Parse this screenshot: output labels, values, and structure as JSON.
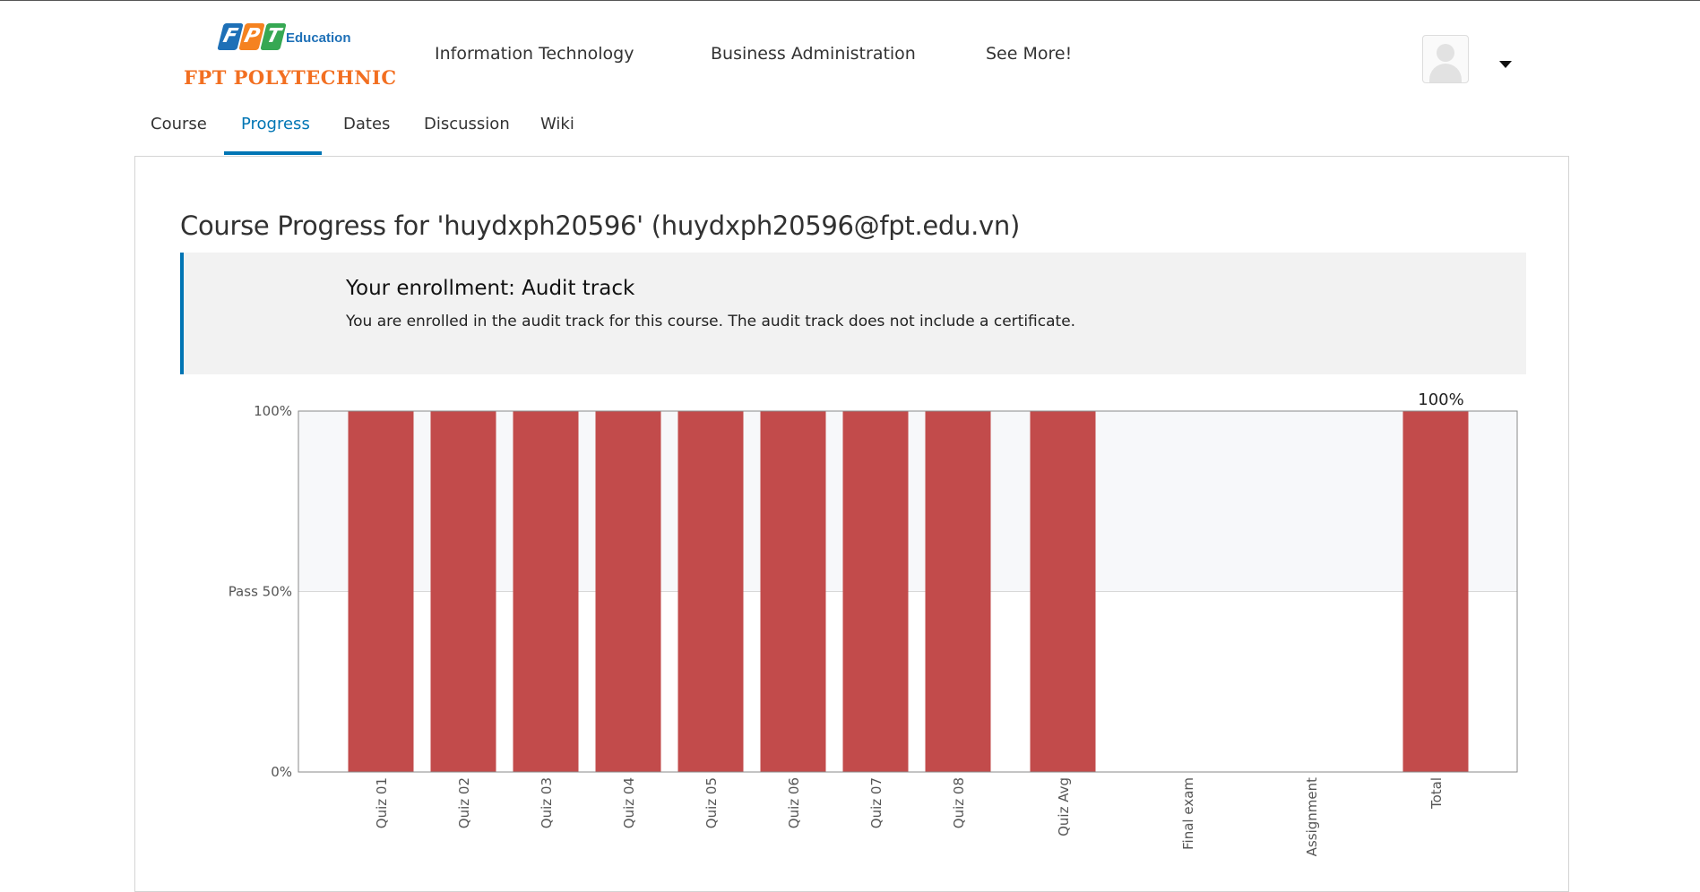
{
  "header": {
    "logo": {
      "brand": "FPT",
      "tagline": "Education",
      "name": "FPT POLYTECHNIC"
    },
    "nav": [
      "Information Technology",
      "Business Administration",
      "See More!"
    ]
  },
  "course_tabs": [
    "Course",
    "Progress",
    "Dates",
    "Discussion",
    "Wiki"
  ],
  "active_tab": "Progress",
  "page_title": "Course Progress for 'huydxph20596' (huydxph20596@fpt.edu.vn)",
  "enrollment": {
    "heading": "Your enrollment: Audit track",
    "text": "You are enrolled in the audit track for this course. The audit track does not include a certificate."
  },
  "colors": {
    "accent": "#0075b4",
    "bar": "#c24b4b",
    "pass_band": "#f7f8fa"
  },
  "chart_data": {
    "type": "bar",
    "categories": [
      "Quiz 01",
      "Quiz 02",
      "Quiz 03",
      "Quiz 04",
      "Quiz 05",
      "Quiz 06",
      "Quiz 07",
      "Quiz 08",
      "Quiz Avg",
      "Final exam",
      "Assignment",
      "Total"
    ],
    "values": [
      100,
      100,
      100,
      100,
      100,
      100,
      100,
      100,
      100,
      0,
      0,
      100
    ],
    "ylim": [
      0,
      100
    ],
    "yticks": [
      {
        "value": 0,
        "label": "0%"
      },
      {
        "value": 50,
        "label": "Pass 50%"
      },
      {
        "value": 100,
        "label": "100%"
      }
    ],
    "pass_threshold": 50,
    "total_label": "100%"
  }
}
